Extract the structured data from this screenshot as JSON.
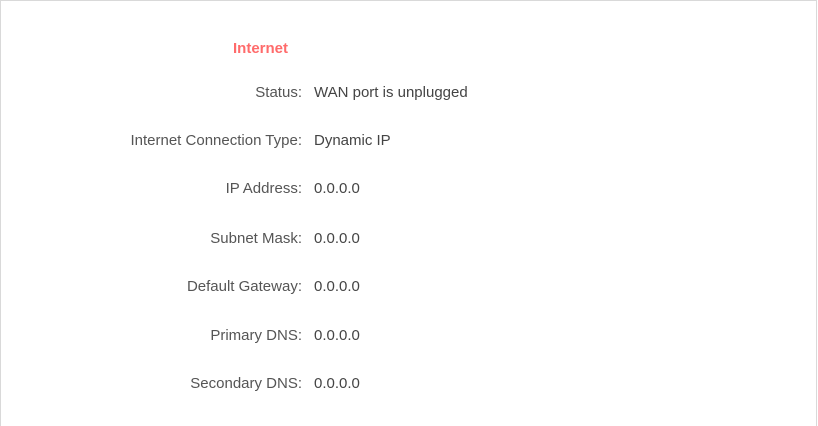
{
  "internet": {
    "title": "Internet",
    "rows": [
      {
        "label": "Status:",
        "value": "WAN port is unplugged"
      },
      {
        "label": "Internet Connection Type:",
        "value": "Dynamic IP"
      },
      {
        "label": "IP Address:",
        "value": "0.0.0.0"
      },
      {
        "label": "Subnet Mask:",
        "value": "0.0.0.0"
      },
      {
        "label": "Default Gateway:",
        "value": "0.0.0.0"
      },
      {
        "label": "Primary DNS:",
        "value": "0.0.0.0"
      },
      {
        "label": "Secondary DNS:",
        "value": "0.0.0.0"
      }
    ]
  },
  "colors": {
    "section_title": "#ff6b6b",
    "label_text": "#555555",
    "value_text": "#444444",
    "border": "#d9d9d9"
  }
}
